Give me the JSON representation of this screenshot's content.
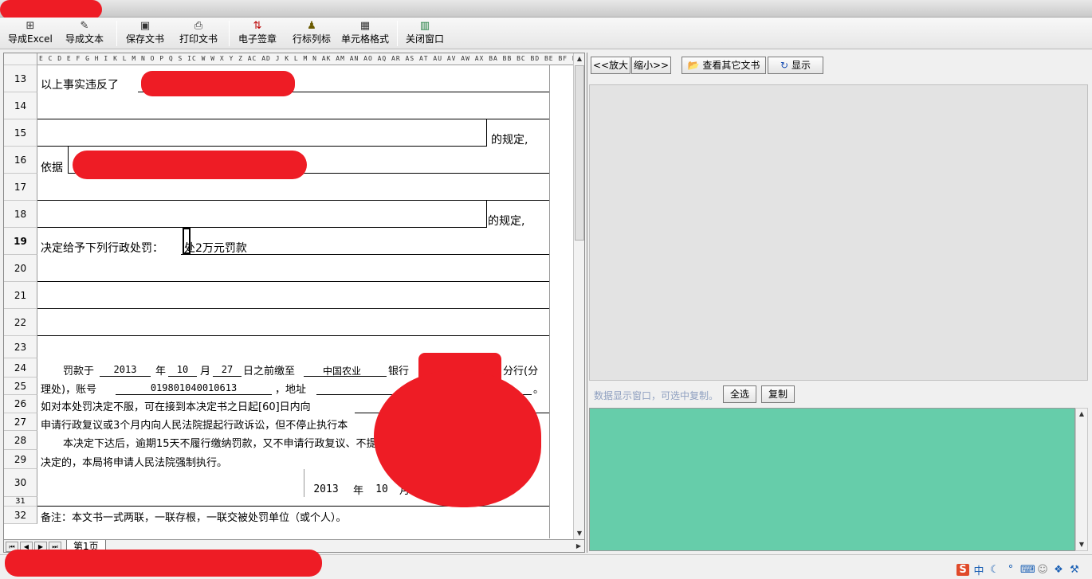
{
  "toolbar": {
    "export_excel": "导成Excel",
    "export_text": "导成文本",
    "save_doc": "保存文书",
    "print_doc": "打印文书",
    "e_sign": "电子签章",
    "row_col": "行标列标",
    "cell_format": "单元格格式",
    "close_window": "关闭窗口"
  },
  "sheet": {
    "column_header": "E C D E F G H I K L M N O P Q  S  IC W W  X   Y  Z  AC  AD J K L M N AK  AM AN AO AQ AR AS AT AU AV AW AX BA BB BC BD BE BF BG BH BI",
    "rows": [
      "13",
      "14",
      "15",
      "16",
      "17",
      "18",
      "19",
      "20",
      "21",
      "22",
      "23",
      "24",
      "25",
      "26",
      "27",
      "28",
      "29",
      "30",
      "31",
      "32"
    ],
    "active_row": "19",
    "r13_text": "以上事实违反了",
    "r15_suffix": "的规定,",
    "r16_text": "依据",
    "r18_suffix": "的规定,",
    "r19_text": "决定给予下列行政处罚：",
    "r19_value": "处2万元罚款",
    "r24_fine_at": "罚款于",
    "r24_year_val": "2013",
    "r24_year": "年",
    "r24_month_val": "10",
    "r24_month": "月",
    "r24_day_val": "27",
    "r24_before": "日之前缴至",
    "r24_bank_val": "中国农业",
    "r24_bank": "银行",
    "r24_branch": "分行(分",
    "r25_prefix": "理处)，账号",
    "r25_account": "019801040010613",
    "r25_addr": "，地址",
    "r25_end": "。",
    "r26_text": "如对本处罚决定不服，可在接到本决定书之日起[60]日内向",
    "r27_text": "申请行政复议或3个月内向人民法院提起行政诉讼，但不停止执行本",
    "r28_text": "本决定下达后，逾期15天不履行缴纳罚款，又不申请行政复议、不提",
    "r29_text": "决定的，本局将申请人民法院强制执行。",
    "r30_year": "2013",
    "r30_year_label": "年",
    "r30_month": "10",
    "r30_month_label": "月",
    "r32_text": "备注：本文书一式两联，一联存根，一联交被处罚单位（或个人）。",
    "sheet_tab": "第1页"
  },
  "right": {
    "zoom_in": "<<放大",
    "zoom_out": "缩小>>",
    "view_other": "查看其它文书",
    "show": "显示",
    "hint": "数据显示窗口，可选中复制。",
    "select_all": "全选",
    "copy": "复制"
  },
  "tray": {
    "ime": "中"
  },
  "colors": {
    "redaction": "#ee1c25",
    "text_area": "#66cdaa"
  }
}
